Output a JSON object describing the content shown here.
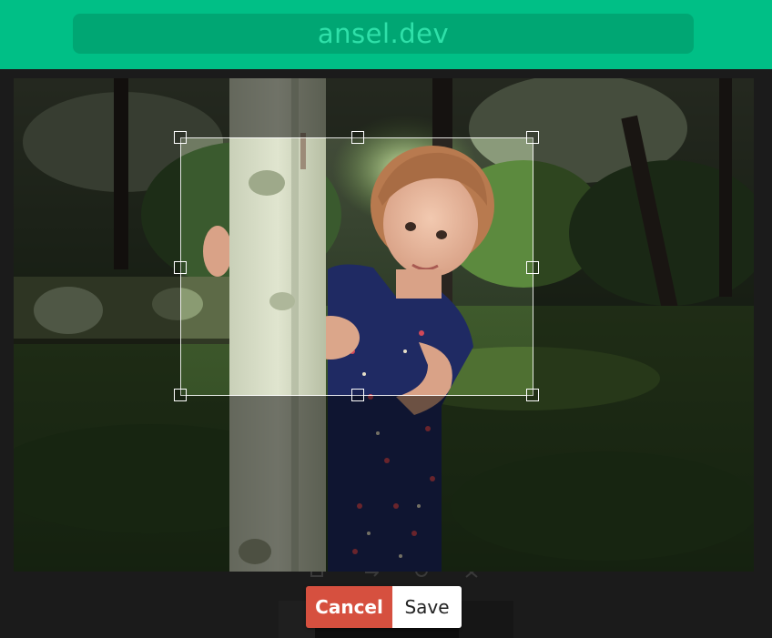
{
  "header": {
    "url": "ansel.dev",
    "bar_color": "#00bf86",
    "url_box_color": "#00a673"
  },
  "editor": {
    "image": "photo-girl-behind-tree-post",
    "crop_overlay": "crop-selection-with-8-resize-handles",
    "toolbar_icons": [
      "crop-icon",
      "flip-icon",
      "rotate-icon",
      "resize-icon"
    ]
  },
  "actions": {
    "cancel_label": "Cancel",
    "save_label": "Save",
    "cancel_color": "#d6503f"
  }
}
